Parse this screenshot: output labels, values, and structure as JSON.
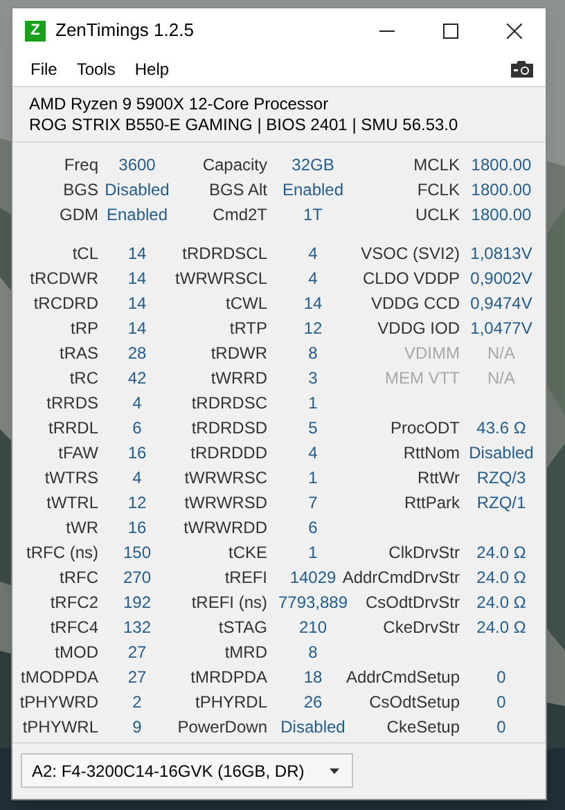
{
  "window": {
    "title": "ZenTimings 1.2.5",
    "icon_letter": "Z"
  },
  "menu": [
    "File",
    "Tools",
    "Help"
  ],
  "info": [
    "AMD Ryzen 9 5900X 12-Core Processor",
    "ROG STRIX B550-E GAMING | BIOS 2401 | SMU 56.53.0"
  ],
  "summary_rows": [
    [
      {
        "label": "Freq",
        "value": "3600",
        "disabled": false
      },
      {
        "label": "Capacity",
        "value": "32GB",
        "disabled": false
      },
      {
        "label": "MCLK",
        "value": "1800.00",
        "disabled": false
      }
    ],
    [
      {
        "label": "BGS",
        "value": "Disabled",
        "disabled": false
      },
      {
        "label": "BGS Alt",
        "value": "Enabled",
        "disabled": false
      },
      {
        "label": "FCLK",
        "value": "1800.00",
        "disabled": false
      }
    ],
    [
      {
        "label": "GDM",
        "value": "Enabled",
        "disabled": false
      },
      {
        "label": "Cmd2T",
        "value": "1T",
        "disabled": false
      },
      {
        "label": "UCLK",
        "value": "1800.00",
        "disabled": false
      }
    ]
  ],
  "timing_rows": [
    [
      {
        "label": "tCL",
        "value": "14",
        "disabled": false
      },
      {
        "label": "tRDRDSCL",
        "value": "4",
        "disabled": false
      },
      {
        "label": "VSOC (SVI2)",
        "value": "1,0813V",
        "disabled": false
      }
    ],
    [
      {
        "label": "tRCDWR",
        "value": "14",
        "disabled": false
      },
      {
        "label": "tWRWRSCL",
        "value": "4",
        "disabled": false
      },
      {
        "label": "CLDO VDDP",
        "value": "0,9002V",
        "disabled": false
      }
    ],
    [
      {
        "label": "tRCDRD",
        "value": "14",
        "disabled": false
      },
      {
        "label": "tCWL",
        "value": "14",
        "disabled": false
      },
      {
        "label": "VDDG CCD",
        "value": "0,9474V",
        "disabled": false
      }
    ],
    [
      {
        "label": "tRP",
        "value": "14",
        "disabled": false
      },
      {
        "label": "tRTP",
        "value": "12",
        "disabled": false
      },
      {
        "label": "VDDG IOD",
        "value": "1,0477V",
        "disabled": false
      }
    ],
    [
      {
        "label": "tRAS",
        "value": "28",
        "disabled": false
      },
      {
        "label": "tRDWR",
        "value": "8",
        "disabled": false
      },
      {
        "label": "VDIMM",
        "value": "N/A",
        "disabled": true
      }
    ],
    [
      {
        "label": "tRC",
        "value": "42",
        "disabled": false
      },
      {
        "label": "tWRRD",
        "value": "3",
        "disabled": false
      },
      {
        "label": "MEM VTT",
        "value": "N/A",
        "disabled": true
      }
    ],
    [
      {
        "label": "tRRDS",
        "value": "4",
        "disabled": false
      },
      {
        "label": "tRDRDSC",
        "value": "1",
        "disabled": false
      },
      null
    ],
    [
      {
        "label": "tRRDL",
        "value": "6",
        "disabled": false
      },
      {
        "label": "tRDRDSD",
        "value": "5",
        "disabled": false
      },
      {
        "label": "ProcODT",
        "value": "43.6 Ω",
        "disabled": false
      }
    ],
    [
      {
        "label": "tFAW",
        "value": "16",
        "disabled": false
      },
      {
        "label": "tRDRDDD",
        "value": "4",
        "disabled": false
      },
      {
        "label": "RttNom",
        "value": "Disabled",
        "disabled": false
      }
    ],
    [
      {
        "label": "tWTRS",
        "value": "4",
        "disabled": false
      },
      {
        "label": "tWRWRSC",
        "value": "1",
        "disabled": false
      },
      {
        "label": "RttWr",
        "value": "RZQ/3",
        "disabled": false
      }
    ],
    [
      {
        "label": "tWTRL",
        "value": "12",
        "disabled": false
      },
      {
        "label": "tWRWRSD",
        "value": "7",
        "disabled": false
      },
      {
        "label": "RttPark",
        "value": "RZQ/1",
        "disabled": false
      }
    ],
    [
      {
        "label": "tWR",
        "value": "16",
        "disabled": false
      },
      {
        "label": "tWRWRDD",
        "value": "6",
        "disabled": false
      },
      null
    ],
    [
      {
        "label": "tRFC (ns)",
        "value": "150",
        "disabled": false
      },
      {
        "label": "tCKE",
        "value": "1",
        "disabled": false
      },
      {
        "label": "ClkDrvStr",
        "value": "24.0 Ω",
        "disabled": false
      }
    ],
    [
      {
        "label": "tRFC",
        "value": "270",
        "disabled": false
      },
      {
        "label": "tREFI",
        "value": "14029",
        "disabled": false
      },
      {
        "label": "AddrCmdDrvStr",
        "value": "24.0 Ω",
        "disabled": false
      }
    ],
    [
      {
        "label": "tRFC2",
        "value": "192",
        "disabled": false
      },
      {
        "label": "tREFI (ns)",
        "value": "7793,889",
        "disabled": false
      },
      {
        "label": "CsOdtDrvStr",
        "value": "24.0 Ω",
        "disabled": false
      }
    ],
    [
      {
        "label": "tRFC4",
        "value": "132",
        "disabled": false
      },
      {
        "label": "tSTAG",
        "value": "210",
        "disabled": false
      },
      {
        "label": "CkeDrvStr",
        "value": "24.0 Ω",
        "disabled": false
      }
    ],
    [
      {
        "label": "tMOD",
        "value": "27",
        "disabled": false
      },
      {
        "label": "tMRD",
        "value": "8",
        "disabled": false
      },
      null
    ],
    [
      {
        "label": "tMODPDA",
        "value": "27",
        "disabled": false
      },
      {
        "label": "tMRDPDA",
        "value": "18",
        "disabled": false
      },
      {
        "label": "AddrCmdSetup",
        "value": "0",
        "disabled": false
      }
    ],
    [
      {
        "label": "tPHYWRD",
        "value": "2",
        "disabled": false
      },
      {
        "label": "tPHYRDL",
        "value": "26",
        "disabled": false
      },
      {
        "label": "CsOdtSetup",
        "value": "0",
        "disabled": false
      }
    ],
    [
      {
        "label": "tPHYWRL",
        "value": "9",
        "disabled": false
      },
      {
        "label": "PowerDown",
        "value": "Disabled",
        "disabled": false
      },
      {
        "label": "CkeSetup",
        "value": "0",
        "disabled": false
      }
    ]
  ],
  "module_select": {
    "value": "A2: F4-3200C14-16GVK (16GB, DR)"
  }
}
